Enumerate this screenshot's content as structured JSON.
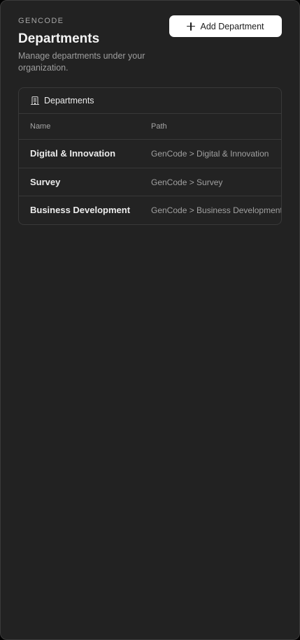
{
  "header": {
    "org": "GENCODE",
    "title": "Departments",
    "description": "Manage departments under your organization.",
    "add_button_label": "Add Department"
  },
  "card": {
    "title": "Departments",
    "icon": "building-icon",
    "columns": {
      "name": "Name",
      "path": "Path"
    },
    "rows": [
      {
        "name": "Digital & Innovation",
        "path": "GenCode > Digital & Innovation"
      },
      {
        "name": "Survey",
        "path": "GenCode > Survey"
      },
      {
        "name": "Business Development",
        "path": "GenCode > Business Development"
      }
    ]
  },
  "colors": {
    "background": "#222222",
    "button_bg": "#ffffff"
  }
}
